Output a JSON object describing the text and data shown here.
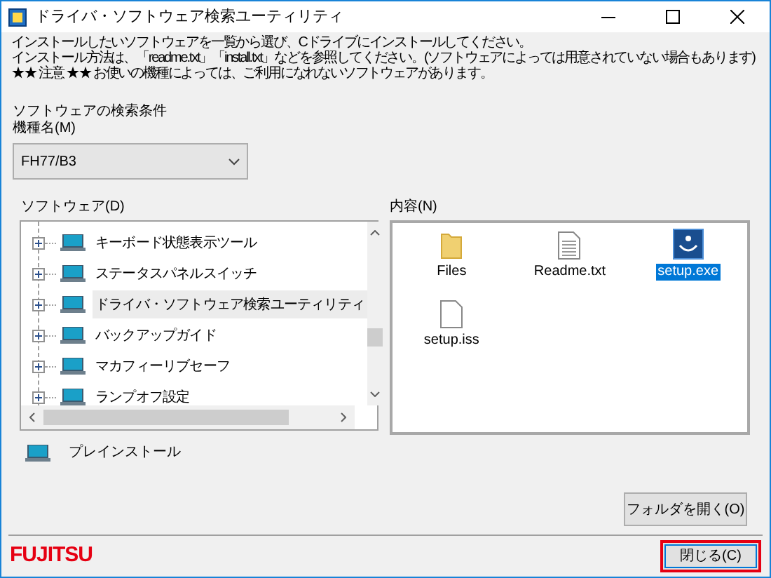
{
  "window": {
    "title": "ドライバ・ソフトウェア検索ユーティリティ"
  },
  "instructions": [
    "インストールしたいソフトウェアを一覧から選び、Cドライブにインストールしてください。",
    "インストール方法は、「readme.txt」「install.txt」などを参照してください。(ソフトウェアによっては用意されていない場合もあります)",
    "★★ 注意 ★★ お使いの機種によっては、ご利用になれないソフトウェアがあります。"
  ],
  "search_conditions": {
    "heading": "ソフトウェアの検索条件",
    "model_label": "機種名(M)",
    "model_value": "FH77/B3"
  },
  "software": {
    "label": "ソフトウェア(D)",
    "items": [
      {
        "label": "キーボード状態表示ツール",
        "selected": false
      },
      {
        "label": "ステータスパネルスイッチ",
        "selected": false
      },
      {
        "label": "ドライバ・ソフトウェア検索ユーティリティ",
        "selected": true
      },
      {
        "label": "バックアップガイド",
        "selected": false
      },
      {
        "label": "マカフィーリブセーフ",
        "selected": false
      },
      {
        "label": "ランプオフ設定",
        "selected": false
      }
    ]
  },
  "legend": {
    "label": "プレインストール"
  },
  "contents": {
    "label": "内容(N)",
    "items": [
      {
        "kind": "folder",
        "label": "Files",
        "selected": false
      },
      {
        "kind": "text",
        "label": "Readme.txt",
        "selected": false
      },
      {
        "kind": "app",
        "label": "setup.exe",
        "selected": true
      },
      {
        "kind": "file",
        "label": "setup.iss",
        "selected": false
      }
    ]
  },
  "buttons": {
    "open_folder": "フォルダを開く(O)",
    "close": "閉じる(C)"
  },
  "logo": "FUJITSU"
}
